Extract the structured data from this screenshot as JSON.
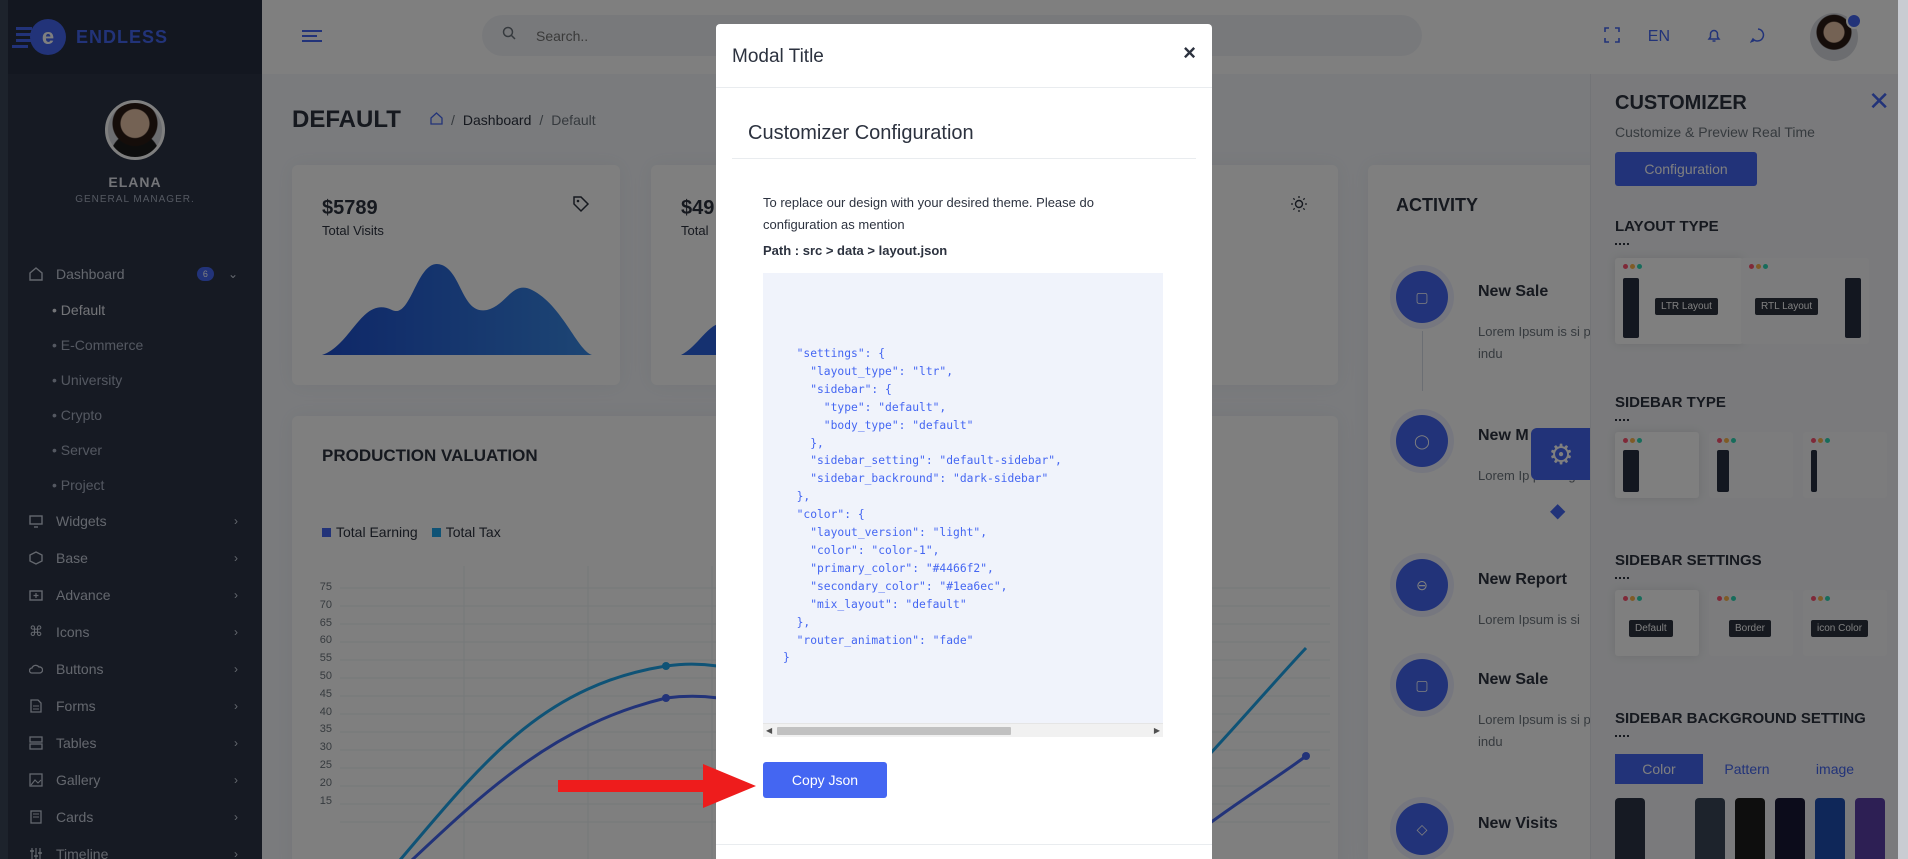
{
  "brand": {
    "name": "ENDLESS"
  },
  "profile": {
    "name": "ELANA",
    "role": "GENERAL MANAGER."
  },
  "sidebar": {
    "dashboard": {
      "label": "Dashboard",
      "badge": "6"
    },
    "sub_items": [
      {
        "label": "• Default"
      },
      {
        "label": "• E-Commerce"
      },
      {
        "label": "• University"
      },
      {
        "label": "• Crypto"
      },
      {
        "label": "• Server"
      },
      {
        "label": "• Project"
      }
    ],
    "items": [
      {
        "label": "Widgets",
        "icon": "monitor-icon"
      },
      {
        "label": "Base",
        "icon": "box-icon"
      },
      {
        "label": "Advance",
        "icon": "folder-plus-icon"
      },
      {
        "label": "Icons",
        "icon": "command-icon"
      },
      {
        "label": "Buttons",
        "icon": "cloud-icon"
      },
      {
        "label": "Forms",
        "icon": "file-text-icon"
      },
      {
        "label": "Tables",
        "icon": "server-icon"
      },
      {
        "label": "Gallery",
        "icon": "image-icon"
      },
      {
        "label": "Cards",
        "icon": "book-icon"
      },
      {
        "label": "Timeline",
        "icon": "sliders-icon"
      }
    ]
  },
  "topbar": {
    "search_placeholder": "Search..",
    "language": "EN"
  },
  "page": {
    "title": "DEFAULT",
    "breadcrumb": {
      "parent": "Dashboard",
      "current": "Default"
    }
  },
  "stats": [
    {
      "value": "$5789",
      "label": "Total Visits",
      "icon": "tag-icon"
    },
    {
      "value": "$49",
      "label": "Total",
      "icon": ""
    },
    {
      "value": "",
      "label": "",
      "icon": "sun-icon"
    }
  ],
  "production": {
    "title": "PRODUCTION VALUATION",
    "legend": [
      {
        "name": "Total Earning",
        "color": "#4466f2"
      },
      {
        "name": "Total Tax",
        "color": "#1ea6ec"
      }
    ],
    "y_ticks": [
      "75",
      "70",
      "65",
      "60",
      "55",
      "50",
      "45",
      "40",
      "35",
      "30",
      "25",
      "20",
      "15"
    ]
  },
  "activity": {
    "title": "ACTIVITY",
    "items": [
      {
        "name": "New Sale",
        "text": "Lorem Ipsum is si printing and types has been the indu",
        "icon": "shopping-bag-icon"
      },
      {
        "name": "New M",
        "text": "Lorem Ip printing a has been the indu",
        "icon": "message-circle-icon"
      },
      {
        "name": "New Report",
        "text": "Lorem Ipsum is si",
        "icon": "minus-circle-icon"
      },
      {
        "name": "New Sale",
        "text": "Lorem Ipsum is si printing and types has been the indu",
        "icon": "shopping-bag-icon"
      },
      {
        "name": "New Visits",
        "text": "",
        "icon": "tag-icon"
      }
    ]
  },
  "customizer": {
    "title": "CUSTOMIZER",
    "subtitle": "Customize & Preview Real Time",
    "config_button": "Configuration",
    "layout_type": {
      "heading": "LAYOUT TYPE",
      "options": [
        "LTR Layout",
        "RTL Layout"
      ]
    },
    "sidebar_type": {
      "heading": "SIDEBAR TYPE"
    },
    "sidebar_settings": {
      "heading": "SIDEBAR SETTINGS",
      "options": [
        "Default",
        "Border",
        "icon Color"
      ]
    },
    "sidebar_background": {
      "heading": "SIDEBAR BACKGROUND SETTING",
      "tabs": [
        "Color",
        "Pattern",
        "image"
      ],
      "swatches": [
        "#2c3547",
        "#f4f5f8",
        "#3b4659",
        "#1c1c1c",
        "#191936",
        "#1e4fb3",
        "#5b3ea8"
      ]
    }
  },
  "modal": {
    "title": "Modal Title",
    "config_title": "Customizer Configuration",
    "description": "To replace our design with your desired theme. Please do configuration as mention",
    "path": "Path : src > data > layout.json",
    "code": "  \"settings\": {\n    \"layout_type\": \"ltr\",\n    \"sidebar\": {\n      \"type\": \"default\",\n      \"body_type\": \"default\"\n    },\n    \"sidebar_setting\": \"default-sidebar\",\n    \"sidebar_backround\": \"dark-sidebar\"\n  },\n  \"color\": {\n    \"layout_version\": \"light\",\n    \"color\": \"color-1\",\n    \"primary_color\": \"#4466f2\",\n    \"secondary_color\": \"#1ea6ec\",\n    \"mix_layout\": \"default\"\n  },\n  \"router_animation\": \"fade\"\n}",
    "copy_button": "Copy Json"
  }
}
